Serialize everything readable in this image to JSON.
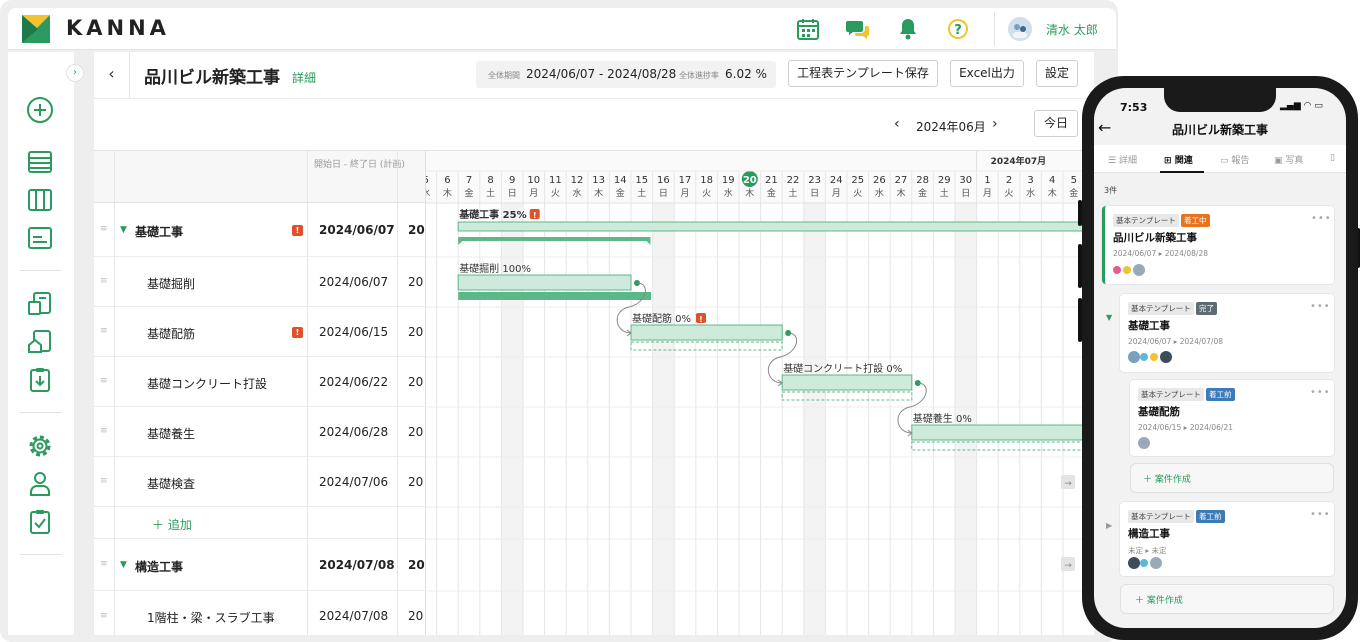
{
  "app": {
    "logo_text": "KANNA",
    "user_name": "清水 太郎"
  },
  "icons": {
    "top": [
      "calendar-icon",
      "chat-icon",
      "bell-icon",
      "help-icon"
    ],
    "nav": [
      "add-icon",
      "list-icon",
      "board-icon",
      "card-icon",
      "building-doc-icon",
      "house-doc-icon",
      "clipboard-download-icon",
      "gear-icon",
      "person-icon",
      "checklist-icon"
    ]
  },
  "colors": {
    "brand_green": "#2a9a5e",
    "bar_fill": "#cdeadb",
    "bar_stroke": "#5cb888",
    "group_bar": "#5cb888",
    "warn": "#e0502b",
    "badge_orange": "#e8731f",
    "badge_gray": "#5f6b73",
    "badge_blue": "#3d7ab8"
  },
  "header": {
    "back": "‹",
    "title": "品川ビル新築工事",
    "detail_link": "詳細",
    "period_label": "全体期間",
    "period_value": "2024/06/07 - 2024/08/28",
    "progress_label": "全体進捗率",
    "progress_value": "6.02 %",
    "buttons": {
      "save_template": "工程表テンプレート保存",
      "excel": "Excel出力",
      "settings": "設定"
    }
  },
  "month_nav": {
    "prev": "‹",
    "label": "2024年06月",
    "next": "›",
    "today": "今日"
  },
  "table": {
    "date_header": "開始日 - 終了日 (計画)",
    "drag_glyph": "≡",
    "caret": "▼",
    "warn_glyph": "!",
    "add_label": "＋ 追加",
    "rows": [
      {
        "name": "基礎工事",
        "start": "2024/06/07",
        "end": "20",
        "group": true,
        "warn": true
      },
      {
        "name": "基礎掘削",
        "start": "2024/06/07",
        "end": "20",
        "group": false,
        "warn": false
      },
      {
        "name": "基礎配筋",
        "start": "2024/06/15",
        "end": "20",
        "group": false,
        "warn": true
      },
      {
        "name": "基礎コンクリート打設",
        "start": "2024/06/22",
        "end": "20",
        "group": false,
        "warn": false
      },
      {
        "name": "基礎養生",
        "start": "2024/06/28",
        "end": "20",
        "group": false,
        "warn": false
      },
      {
        "name": "基礎検査",
        "start": "2024/07/06",
        "end": "20",
        "group": false,
        "warn": false
      },
      {
        "name": "構造工事",
        "start": "2024/07/08",
        "end": "20",
        "group": true,
        "warn": false
      },
      {
        "name": "1階柱・梁・スラブ工事",
        "start": "2024/07/08",
        "end": "20",
        "group": false,
        "warn": false
      }
    ]
  },
  "gantt": {
    "next_month_label": "2024年07月",
    "today_day": "20",
    "days": [
      {
        "d": "5",
        "w": "水"
      },
      {
        "d": "6",
        "w": "木"
      },
      {
        "d": "7",
        "w": "金"
      },
      {
        "d": "8",
        "w": "土"
      },
      {
        "d": "9",
        "w": "日"
      },
      {
        "d": "10",
        "w": "月"
      },
      {
        "d": "11",
        "w": "火"
      },
      {
        "d": "12",
        "w": "水"
      },
      {
        "d": "13",
        "w": "木"
      },
      {
        "d": "14",
        "w": "金"
      },
      {
        "d": "15",
        "w": "土"
      },
      {
        "d": "16",
        "w": "日"
      },
      {
        "d": "17",
        "w": "月"
      },
      {
        "d": "18",
        "w": "火"
      },
      {
        "d": "19",
        "w": "水"
      },
      {
        "d": "20",
        "w": "木"
      },
      {
        "d": "21",
        "w": "金"
      },
      {
        "d": "22",
        "w": "土"
      },
      {
        "d": "23",
        "w": "日"
      },
      {
        "d": "24",
        "w": "月"
      },
      {
        "d": "25",
        "w": "火"
      },
      {
        "d": "26",
        "w": "水"
      },
      {
        "d": "27",
        "w": "木"
      },
      {
        "d": "28",
        "w": "金"
      },
      {
        "d": "29",
        "w": "土"
      },
      {
        "d": "30",
        "w": "日"
      },
      {
        "d": "1",
        "w": "月"
      },
      {
        "d": "2",
        "w": "火"
      },
      {
        "d": "3",
        "w": "水"
      },
      {
        "d": "4",
        "w": "木"
      },
      {
        "d": "5",
        "w": "金"
      }
    ],
    "bars": [
      {
        "label": "基礎工事",
        "pct": "25%",
        "warn": true
      },
      {
        "label": "基礎掘削",
        "pct": "100%",
        "warn": false
      },
      {
        "label": "基礎配筋",
        "pct": "0%",
        "warn": true
      },
      {
        "label": "基礎コンクリート打設",
        "pct": "0%",
        "warn": false
      },
      {
        "label": "基礎養生",
        "pct": "0%",
        "warn": false
      }
    ]
  },
  "phone": {
    "time": "7:53",
    "status_icons": "▂▄▆ ◠ ▭",
    "back": "←",
    "title": "品川ビル新築工事",
    "tabs": [
      "詳細",
      "関連",
      "報告",
      "写真"
    ],
    "active_tab": "関連",
    "count": "3件",
    "cards": [
      {
        "template": "基本テンプレート",
        "status": "着工中",
        "name": "品川ビル新築工事",
        "dates": "2024/06/07 ▸ 2024/08/28"
      },
      {
        "template": "基本テンプレート",
        "status": "完了",
        "name": "基礎工事",
        "dates": "2024/06/07 ▸ 2024/07/08"
      },
      {
        "template": "基本テンプレート",
        "status": "着工前",
        "name": "基礎配筋",
        "dates": "2024/06/15 ▸ 2024/06/21"
      },
      {
        "template": "基本テンプレート",
        "status": "着工前",
        "name": "構造工事",
        "dates": "未定 ▸ 未定"
      }
    ],
    "create_label": "＋ 案件作成",
    "more": "•••"
  }
}
